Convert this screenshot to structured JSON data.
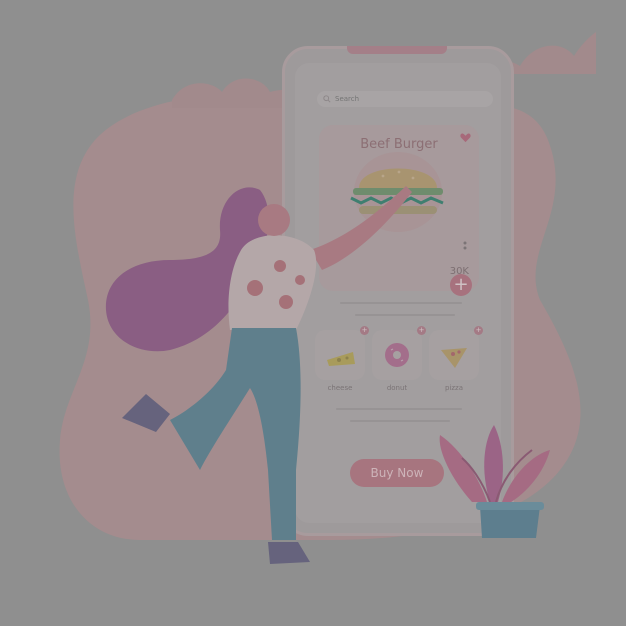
{
  "app": {
    "search": {
      "placeholder": "Search",
      "icon": "search-icon"
    },
    "product": {
      "title": "Beef Burger",
      "price": "30K",
      "favorite_icon": "heart-icon",
      "add_label": "+"
    },
    "categories": [
      {
        "label": "cheese",
        "icon": "cheese-icon",
        "badge": "+"
      },
      {
        "label": "donut",
        "icon": "donut-icon",
        "badge": "+"
      },
      {
        "label": "pizza",
        "icon": "pizza-icon",
        "badge": "+"
      }
    ],
    "cta": {
      "label": "Buy Now"
    }
  },
  "colors": {
    "background": "#8f8f8f",
    "accent": "#a7757f",
    "blob": "#a48c8e",
    "hair": "#8a5e83",
    "jeans": "#5f7f8c",
    "shoes": "#66637d"
  }
}
